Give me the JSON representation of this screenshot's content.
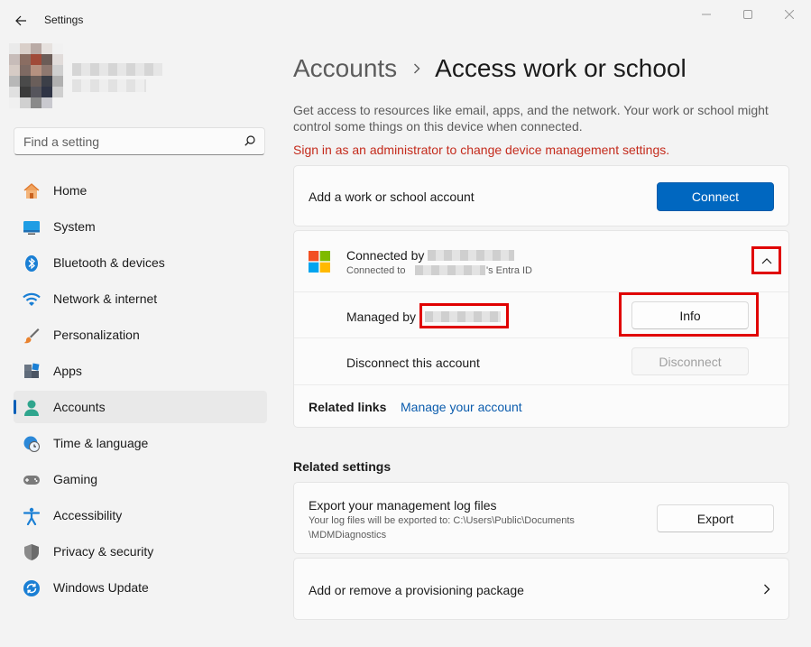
{
  "window": {
    "title": "Settings"
  },
  "search": {
    "placeholder": "Find a setting"
  },
  "sidebar": {
    "items": [
      {
        "label": "Home",
        "icon": "home-icon"
      },
      {
        "label": "System",
        "icon": "system-icon"
      },
      {
        "label": "Bluetooth & devices",
        "icon": "bluetooth-icon"
      },
      {
        "label": "Network & internet",
        "icon": "wifi-icon"
      },
      {
        "label": "Personalization",
        "icon": "brush-icon"
      },
      {
        "label": "Apps",
        "icon": "apps-icon"
      },
      {
        "label": "Accounts",
        "icon": "accounts-icon",
        "selected": true
      },
      {
        "label": "Time & language",
        "icon": "clock-globe-icon"
      },
      {
        "label": "Gaming",
        "icon": "gamepad-icon"
      },
      {
        "label": "Accessibility",
        "icon": "accessibility-icon"
      },
      {
        "label": "Privacy & security",
        "icon": "shield-icon"
      },
      {
        "label": "Windows Update",
        "icon": "update-icon"
      }
    ]
  },
  "breadcrumb": {
    "parent": "Accounts",
    "current": "Access work or school"
  },
  "description": "Get access to resources like email, apps, and the network. Your work or school might control some things on this device when connected.",
  "warning": "Sign in as an administrator to change device management settings.",
  "add_account": {
    "label": "Add a work or school account",
    "button": "Connect"
  },
  "connected_account": {
    "title_prefix": "Connected by",
    "subtitle_prefix": "Connected to",
    "subtitle_suffix": "'s Entra ID",
    "managed_by_label": "Managed by",
    "info_button": "Info",
    "disconnect_label": "Disconnect this account",
    "disconnect_button": "Disconnect",
    "related_links_label": "Related links",
    "manage_link": "Manage your account"
  },
  "related_settings": {
    "heading": "Related settings",
    "export": {
      "title": "Export your management log files",
      "subtitle": "Your log files will be exported to: C:\\Users\\Public\\Documents\\MDMDiagnostics",
      "subtitle_line1": "Your log files will be exported to: C:\\Users\\Public\\Documents",
      "subtitle_line2": "\\MDMDiagnostics",
      "button": "Export"
    },
    "provisioning": {
      "label": "Add or remove a provisioning package"
    }
  },
  "colors": {
    "accent": "#0067c0",
    "warning": "#c42b1c",
    "highlight_box": "#e00000",
    "link": "#0b5cad"
  }
}
